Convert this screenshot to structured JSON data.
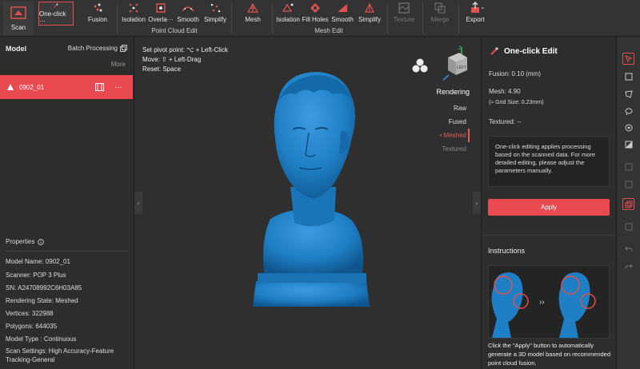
{
  "toolbar": {
    "scan": "Scan",
    "one_click": "One-click ···",
    "fusion": "Fusion",
    "pc_isolation": "Isolation",
    "pc_overlap": "Overla···",
    "pc_smooth": "Smooth",
    "pc_simplify": "Simplify",
    "pc_group": "Point Cloud Edit",
    "mesh": "Mesh",
    "m_isolation": "Isolation",
    "m_fill": "Fill Holes",
    "m_smooth": "Smooth",
    "m_simplify": "Simplify",
    "mesh_group": "Mesh Edit",
    "texture": "Texture",
    "merge": "Merge",
    "export": "Export"
  },
  "left": {
    "header": "Model",
    "batch": "Batch Processing",
    "more": "More",
    "model_name": "0902_01",
    "properties_title": "Properties",
    "props": [
      "Model Name:  0902_01",
      "Scanner:  POP 3 Plus",
      "SN:  A24708992C6H03A85",
      "Rendering State:  Meshed",
      "Vertices:  322988",
      "Polygons:  644035",
      "Model Type :  Continuous",
      "Scan Settings:  High Accuracy-Feature Tracking-General"
    ]
  },
  "view": {
    "hint1": "Set pivot point:  ⌥ + Left-Click",
    "hint2": "Move:  ⇧ + Left-Drag",
    "hint3": "Reset:  Space",
    "rendering_title": "Rendering",
    "modes": [
      "Raw",
      "Fused",
      "• Meshed",
      "Textured"
    ],
    "cube_label": "LEFT",
    "axis_z": "Z",
    "mesh_color": "#1f7fc4"
  },
  "right": {
    "title": "One-click Edit",
    "fusion": "Fusion:   0.10 (mm)",
    "mesh": "Mesh:    4.90",
    "grid": "(≈ Grid Size: 0.23mm)",
    "textured": "Textured: --",
    "info": "One-click editing applies processing based on the scanned data. For more detailed editing, please adjust the parameters manually.",
    "apply": "Apply",
    "instructions": "Instructions",
    "arrow": "››",
    "instr_text": "Click the \"Apply\" button to automatically generate a 3D model based on recommended point cloud fusion,"
  },
  "colors": {
    "accent": "#e84a4f",
    "mesh_blue": "#1f7fc4"
  }
}
